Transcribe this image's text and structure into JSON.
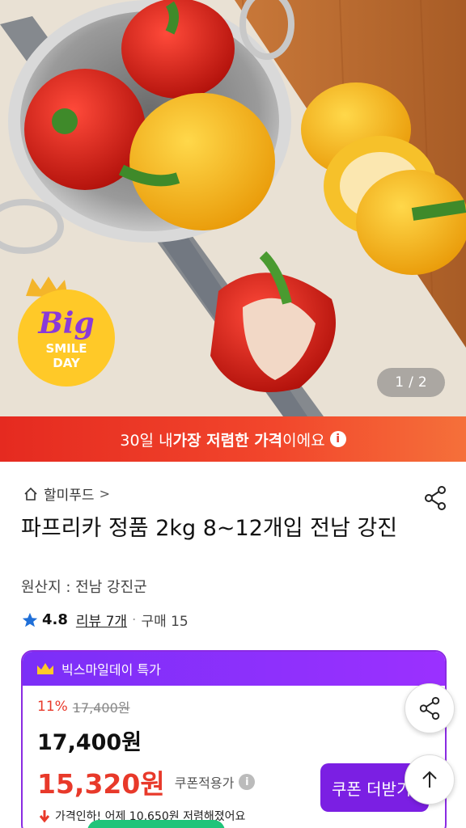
{
  "hero": {
    "page_current": "1",
    "page_sep": "/",
    "page_total": "2",
    "badge": {
      "line1": "Big",
      "line2": "SMILE",
      "line3": "DAY"
    }
  },
  "banner": {
    "pre": "30일 내 ",
    "bold": "가장 저렴한 가격",
    "post": "이에요",
    "info_glyph": "i"
  },
  "product": {
    "seller": "할미푸드",
    "seller_chevron": ">",
    "title": "파프리카 정품 2kg 8~12개입 전남 강진",
    "origin": "원산지 : 전남 강진군",
    "rating": "4.8",
    "review": "리뷰 7개",
    "purchase_sep": "·",
    "purchases": "구매 15"
  },
  "deal": {
    "header": "빅스마일데이 특가",
    "discount_pct": "11%",
    "original_price": "17,400원",
    "price": "17,400원",
    "coupon_price": "15,320원",
    "coupon_label": "쿠폰적용가",
    "coupon_info_glyph": "i",
    "price_drop": "가격인하! 어제 10,650원 저렴해졌어요",
    "coupon_button": "쿠폰 더받기"
  },
  "colors": {
    "accent_red": "#e8392a",
    "deal_purple": "#7b2ff7",
    "star_blue": "#1f6fd8"
  },
  "icons": [
    "home-icon",
    "share-icon",
    "star-icon",
    "crown-icon",
    "arrow-up-icon",
    "down-arrow-icon"
  ]
}
